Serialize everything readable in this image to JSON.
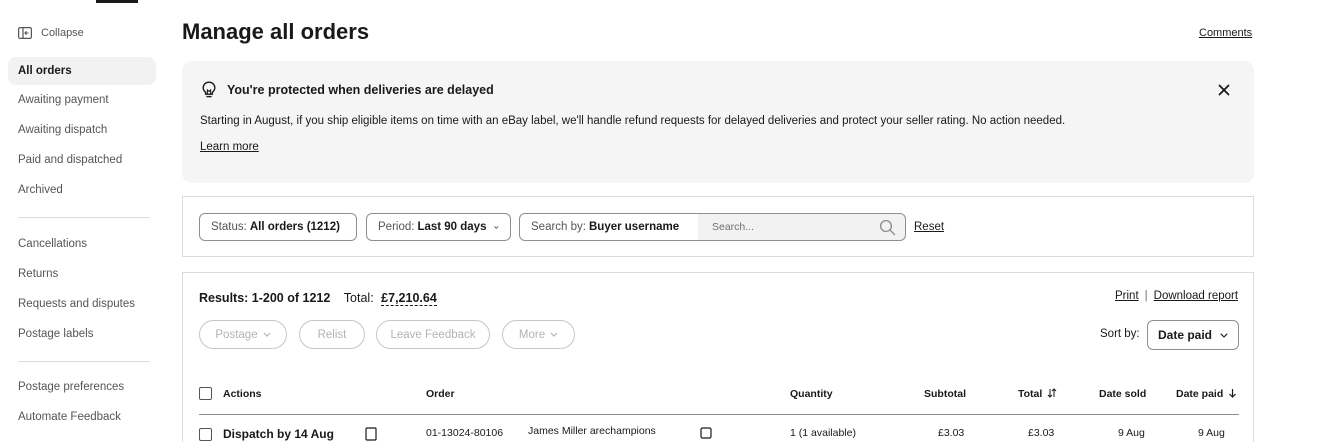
{
  "sidebar": {
    "collapse_label": "Collapse",
    "groups": [
      [
        "All orders",
        "Awaiting payment",
        "Awaiting dispatch",
        "Paid and dispatched",
        "Archived"
      ],
      [
        "Cancellations",
        "Returns",
        "Requests and disputes",
        "Postage labels"
      ],
      [
        "Postage preferences",
        "Automate Feedback"
      ]
    ]
  },
  "header": {
    "title": "Manage all orders",
    "comments_link": "Comments"
  },
  "banner": {
    "title": "You're protected when deliveries are delayed",
    "text": "Starting in August, if you ship eligible items on time with an eBay label, we'll handle refund requests for delayed deliveries and protect your seller rating. No action needed.",
    "learn_more": "Learn more"
  },
  "filters": {
    "status_label": "Status:",
    "status_value": "All orders (1212)",
    "period_label": "Period:",
    "period_value": "Last 90 days",
    "searchby_label": "Search by:",
    "searchby_value": "Buyer username",
    "search_placeholder": "Search...",
    "reset": "Reset"
  },
  "results": {
    "summary": "Results: 1-200 of 1212",
    "total_label": "Total:",
    "total_value": "£7,210.64",
    "print": "Print",
    "download": "Download report",
    "actions": [
      "Postage",
      "Relist",
      "Leave Feedback",
      "More"
    ],
    "sort_label": "Sort by:",
    "sort_value": "Date paid"
  },
  "table": {
    "headers": {
      "actions": "Actions",
      "order": "Order",
      "quantity": "Quantity",
      "subtotal": "Subtotal",
      "total": "Total",
      "date_sold": "Date sold",
      "date_paid": "Date paid"
    },
    "first_row": {
      "action": "Dispatch by 14 Aug",
      "order_no": "01-13024-80106",
      "buyer": "James Miller  arechampions",
      "quantity": "1 (1 available)",
      "subtotal": "£3.03",
      "total": "£3.03",
      "date_sold": "9 Aug",
      "date_paid": "9 Aug"
    }
  }
}
